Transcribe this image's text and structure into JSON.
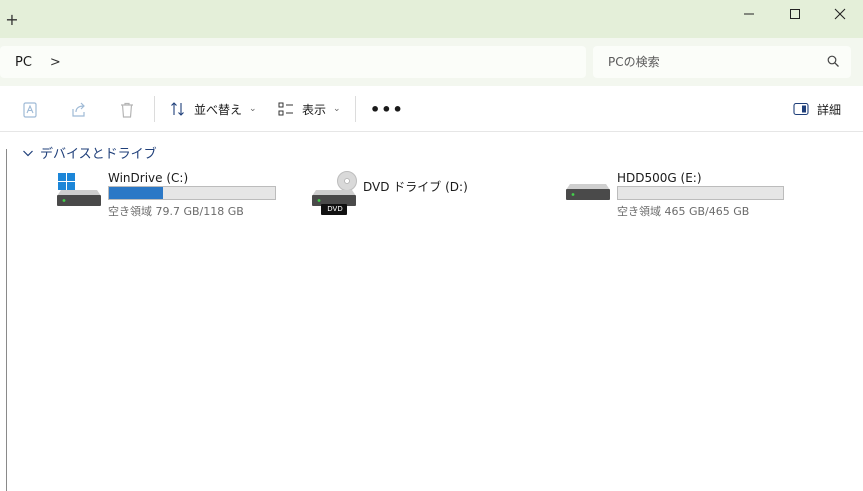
{
  "titlebar": {
    "new_tab": "+"
  },
  "address": {
    "crumb": "PC",
    "separator": ">"
  },
  "search": {
    "placeholder": "PCの検索"
  },
  "toolbar": {
    "sort_label": "並べ替え",
    "view_label": "表示",
    "more_label": "•••",
    "details_label": "詳細",
    "dropdown_glyph": "⌄"
  },
  "group": {
    "title": "デバイスとドライブ"
  },
  "drives": [
    {
      "name": "WinDrive (C:)",
      "space": "空き領域 79.7 GB/118 GB",
      "used_fraction": 0.325
    },
    {
      "name": "DVD ドライブ (D:)",
      "badge": "DVD"
    },
    {
      "name": "HDD500G (E:)",
      "space": "空き領域 465 GB/465 GB",
      "used_fraction": 0.0
    }
  ],
  "colors": {
    "titlebar_bg": "#e4efd9",
    "accent_bar": "#2b78c6",
    "group_header": "#1f3f7a"
  }
}
